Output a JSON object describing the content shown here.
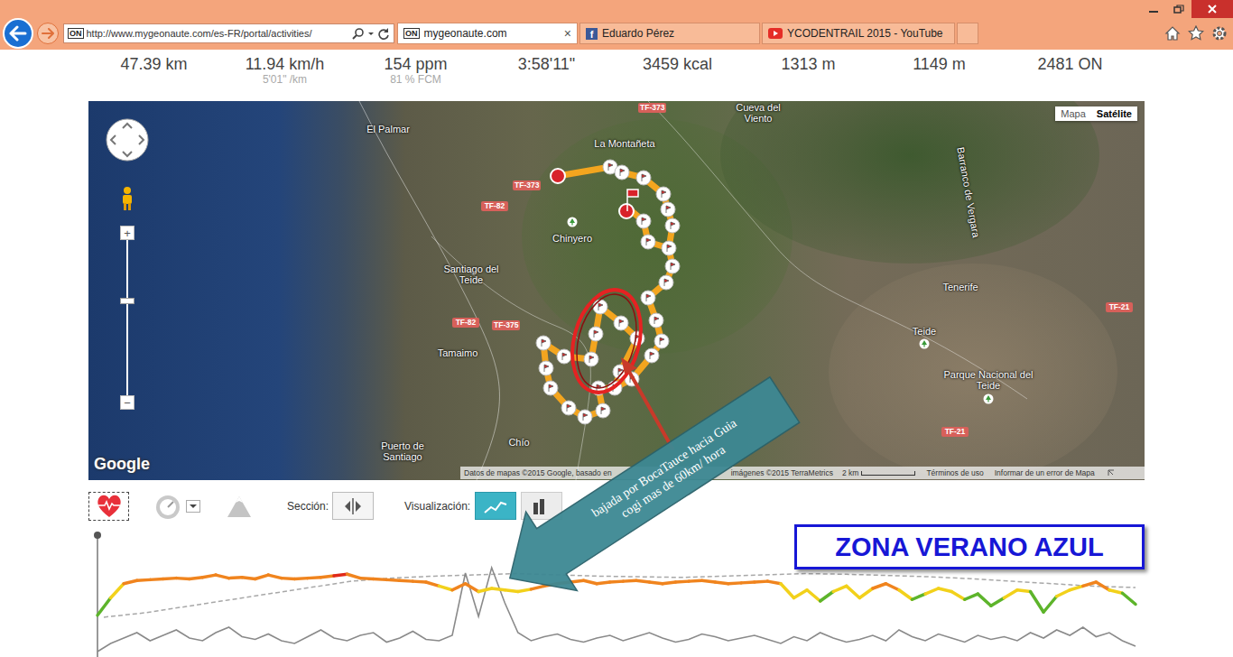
{
  "browser": {
    "address": "http://www.mygeonaute.com/es-FR/portal/activities/",
    "site_badge": "ON",
    "tabs": [
      {
        "label": "mygeonaute.com",
        "selected": true,
        "kind": "site",
        "badge": "ON",
        "close": "×"
      },
      {
        "label": "Eduardo Pérez",
        "selected": false,
        "kind": "facebook",
        "badge": "f"
      },
      {
        "label": "YCODENTRAIL 2015 - YouTube",
        "selected": false,
        "kind": "youtube"
      },
      {
        "label": "",
        "selected": false,
        "kind": "empty"
      }
    ]
  },
  "stats": [
    {
      "value": "47.39 km"
    },
    {
      "value": "11.94 km/h",
      "sub": "5'01\" /km"
    },
    {
      "value": "154 ppm",
      "sub": "81 % FCM"
    },
    {
      "value": "3:58'11\""
    },
    {
      "value": "3459 kcal"
    },
    {
      "value": "1313 m"
    },
    {
      "value": "1149 m"
    },
    {
      "value": "2481 ON"
    }
  ],
  "map": {
    "type_buttons": [
      {
        "label": "Mapa",
        "selected": false
      },
      {
        "label": "Satélite",
        "selected": true
      }
    ],
    "zoom_in": "+",
    "zoom_out": "−",
    "logo": "Google",
    "places": [
      {
        "label": "El Palmar",
        "poi": false
      },
      {
        "label": "La Montañeta",
        "poi": false
      },
      {
        "label": "Cueva del Viento",
        "poi": false
      },
      {
        "label": "Chinyero",
        "poi": true
      },
      {
        "label": "Santiago del Teide",
        "poi": false
      },
      {
        "label": "Tamaimo",
        "poi": false
      },
      {
        "label": "Puerto de Santiago",
        "poi": false
      },
      {
        "label": "Chío",
        "poi": false
      },
      {
        "label": "Tenerife",
        "poi": false
      },
      {
        "label": "Teide",
        "poi": true
      },
      {
        "label": "Parque Nacional del Teide",
        "poi": true
      },
      {
        "label": "Barranco de Vergara",
        "poi": false
      }
    ],
    "roads": [
      "TF-373",
      "TF-373",
      "TF-82",
      "TF-82",
      "TF-375",
      "TF-21",
      "TF-21"
    ],
    "attribution": [
      "Datos de mapas ©2015 Google, basado en",
      "imágenes ©2015 TerraMetrics"
    ],
    "scale": "2 km",
    "links": [
      "Términos de uso",
      "Informar de un error de Mapa"
    ]
  },
  "annotation": {
    "note_lines": [
      "bajada por BocaTauce hacia Guia",
      "cogi mas de 60km/ hora"
    ],
    "zone_label": "ZONA VERANO AZUL"
  },
  "toolbar": {
    "tools": [
      {
        "kind": "heart",
        "selected": true,
        "dropdown": false
      },
      {
        "kind": "gauge",
        "selected": false,
        "dropdown": true
      },
      {
        "kind": "mountain",
        "selected": false,
        "dropdown": false
      }
    ],
    "section_label": "Sección:",
    "view_label": "Visualización:",
    "views": [
      {
        "kind": "line",
        "selected": true
      },
      {
        "kind": "bar",
        "selected": false
      }
    ]
  },
  "chart": {
    "zones": [
      {
        "min": 168,
        "color": "#e0291a"
      },
      {
        "min": 153,
        "color": "#f0841e"
      },
      {
        "min": 143,
        "color": "#f2d11b"
      },
      {
        "min": 128,
        "color": "#5db42b"
      },
      {
        "min": 0,
        "color": "#2a9fc8"
      }
    ],
    "heart_rate": [
      118,
      140,
      158,
      162,
      163,
      164,
      165,
      164,
      166,
      169,
      165,
      166,
      164,
      169,
      165,
      164,
      165,
      166,
      168,
      170,
      165,
      164,
      163,
      162,
      161,
      160,
      155,
      150,
      158,
      148,
      152,
      150,
      148,
      151,
      155,
      158,
      160,
      162,
      158,
      160,
      161,
      162,
      160,
      158,
      160,
      161,
      162,
      160,
      158,
      159,
      160,
      161,
      158,
      140,
      150,
      136,
      148,
      155,
      140,
      152,
      158,
      150,
      138,
      145,
      152,
      148,
      138,
      145,
      130,
      140,
      150,
      148,
      122,
      142,
      150,
      155,
      160,
      150,
      146,
      132
    ],
    "elevation": [
      1230,
      1300,
      1400,
      1500,
      1600,
      1700,
      1800,
      1850,
      1880,
      1900,
      1920,
      1900,
      1880,
      1870,
      1860,
      1880,
      1900,
      1920,
      1910,
      1890,
      1870,
      1840,
      1800,
      1760,
      1720,
      1700
    ],
    "speed": [
      4,
      10,
      14,
      18,
      12,
      16,
      20,
      14,
      12,
      18,
      22,
      15,
      13,
      17,
      12,
      10,
      15,
      20,
      14,
      12,
      16,
      18,
      11,
      14,
      19,
      13,
      12,
      16,
      62,
      30,
      66,
      40,
      18,
      12,
      15,
      17,
      13,
      11,
      14,
      16,
      12,
      15,
      18,
      14,
      11,
      13,
      17,
      15,
      12,
      14,
      16,
      13,
      10,
      15,
      12,
      18,
      14,
      11,
      13,
      16,
      12,
      20,
      15,
      12,
      17,
      14,
      11,
      16,
      13,
      15,
      12,
      18,
      14,
      20,
      16,
      22,
      15,
      18,
      12,
      8
    ]
  }
}
